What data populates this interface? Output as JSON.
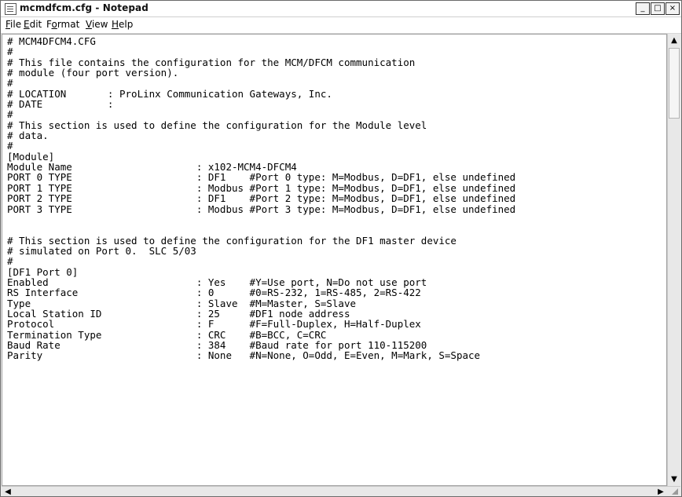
{
  "window": {
    "title": "mcmdfcm.cfg - Notepad",
    "buttons": {
      "minimize": "_",
      "maximize": "□",
      "close": "×"
    }
  },
  "menu": {
    "items": [
      {
        "u": "F",
        "rest": "ile"
      },
      {
        "u": "E",
        "rest": "dit"
      },
      {
        "pre": "F",
        "u": "o",
        "rest": "rmat"
      },
      {
        "u": "V",
        "rest": "iew"
      },
      {
        "u": "H",
        "rest": "elp"
      }
    ]
  },
  "editor": {
    "content": "# MCM4DFCM4.CFG\n#\n# This file contains the configuration for the MCM/DFCM communication\n# module (four port version).\n#\n# LOCATION       : ProLinx Communication Gateways, Inc.\n# DATE           :\n#\n# This section is used to define the configuration for the Module level\n# data.\n#\n[Module]\nModule Name                     : x102-MCM4-DFCM4\nPORT 0 TYPE                     : DF1    #Port 0 type: M=Modbus, D=DF1, else undefined\nPORT 1 TYPE                     : Modbus #Port 1 type: M=Modbus, D=DF1, else undefined\nPORT 2 TYPE                     : DF1    #Port 2 type: M=Modbus, D=DF1, else undefined\nPORT 3 TYPE                     : Modbus #Port 3 type: M=Modbus, D=DF1, else undefined\n\n\n# This section is used to define the configuration for the DF1 master device\n# simulated on Port 0.  SLC 5/03\n#\n[DF1 Port 0]\nEnabled                         : Yes    #Y=Use port, N=Do not use port\nRS Interface                    : 0      #0=RS-232, 1=RS-485, 2=RS-422\nType                            : Slave  #M=Master, S=Slave\nLocal Station ID                : 25     #DF1 node address\nProtocol                        : F      #F=Full-Duplex, H=Half-Duplex\nTermination Type                : CRC    #B=BCC, C=CRC\nBaud Rate                       : 384    #Baud rate for port 110-115200\nParity                          : None   #N=None, O=Odd, E=Even, M=Mark, S=Space"
  },
  "scrollbars": {
    "up": "▲",
    "down": "▼",
    "left": "◀",
    "right": "▶"
  }
}
